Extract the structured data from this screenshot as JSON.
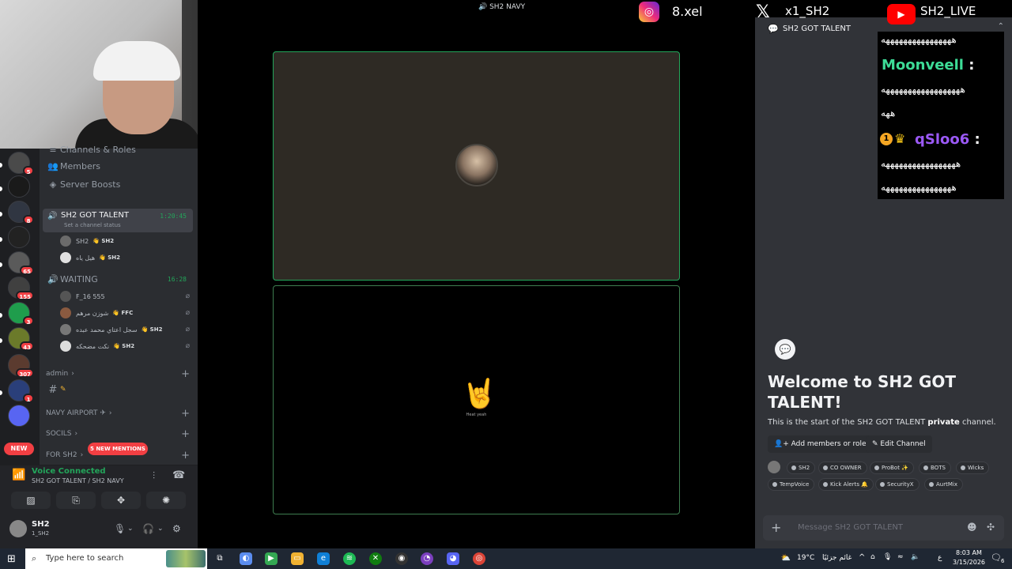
{
  "overlays": {
    "instagram_handle": "8.xel",
    "x_handle": "x1_SH2",
    "youtube_handle": "SH2_LIVE"
  },
  "stage": {
    "channel_label": "SH2 NAVY",
    "tile2_caption": "Heat yeah"
  },
  "sidebar": {
    "top_items": [
      {
        "label": "Channels & Roles"
      },
      {
        "label": "Members"
      },
      {
        "label": "Server Boosts"
      }
    ],
    "active_voice": {
      "name": "SH2 GOT TALENT",
      "timer": "1:20:45",
      "status": "Set a channel status",
      "users": [
        {
          "name": "SH2",
          "tag": "SH2"
        },
        {
          "name": "هيل ياه",
          "tag": "SH2"
        }
      ]
    },
    "waiting_voice": {
      "name": "WAITING",
      "timer": "16:28",
      "users": [
        {
          "name": "F_16 555",
          "tag": ""
        },
        {
          "name": "شوزن مرهم",
          "tag": "FFC"
        },
        {
          "name": "سجل اعتاي محمد عبده",
          "tag": "SH2"
        },
        {
          "name": "نكت مضحكه",
          "tag": "SH2"
        }
      ]
    },
    "categories": [
      "admin",
      "NAVY AIRPORT ✈",
      "SOCILS",
      "FOR SH2"
    ],
    "mentions_pill": "5 NEW MENTIONS",
    "new_pill": "NEW"
  },
  "servers": [
    {
      "badge": "5"
    },
    {
      "badge": ""
    },
    {
      "badge": "8"
    },
    {
      "badge": ""
    },
    {
      "badge": "65"
    },
    {
      "badge": "155"
    },
    {
      "badge": "3"
    },
    {
      "badge": "43"
    },
    {
      "badge": "307"
    },
    {
      "badge": "1"
    },
    {
      "badge": ""
    }
  ],
  "voice_panel": {
    "title": "Voice Connected",
    "subtitle": "SH2 GOT TALENT / SH2 NAVY"
  },
  "user_panel": {
    "name": "SH2",
    "sub": "1_SH2"
  },
  "chat": {
    "header": "SH2 GOT TALENT",
    "overlay_lines": {
      "line1": "ههههههههههههههههه",
      "name1": "Moonveell",
      "line2": "ههههههههههههههههههه",
      "line3": "ههه",
      "rank": "1",
      "name2": "qSloo6",
      "line4": "هههههههههههههههههه",
      "line5": "ههههههههههههههههه"
    },
    "welcome_title": "Welcome to SH2 GOT TALENT!",
    "welcome_desc_prefix": "This is the start of the SH2 GOT TALENT ",
    "welcome_desc_bold": "private",
    "welcome_desc_suffix": " channel.",
    "add_members": "Add members or roles",
    "edit_channel": "Edit Channel",
    "roles": [
      "SH2",
      "CO OWNER",
      "ProBot ✨",
      "BOTS",
      "Wicks",
      "TempVoice",
      "Kick Alerts 🔔",
      "SecurityX",
      "AurtMix"
    ],
    "message_placeholder": "Message SH2 GOT TALENT"
  },
  "taskbar": {
    "search_placeholder": "Type here to search",
    "weather": "19°C",
    "weather_desc": "غائم جزئيًا",
    "lang": "ع",
    "time": "8:03 AM",
    "date": "3/15/2026",
    "notif": "6"
  },
  "colors": {
    "discord_bg": "#313338",
    "sidebar_bg": "#2b2d31",
    "rail_bg": "#1e1f22",
    "green": "#23a55a",
    "red": "#f23f43",
    "moonveell": "#3ddc97",
    "qsloo6": "#9b59f6"
  }
}
